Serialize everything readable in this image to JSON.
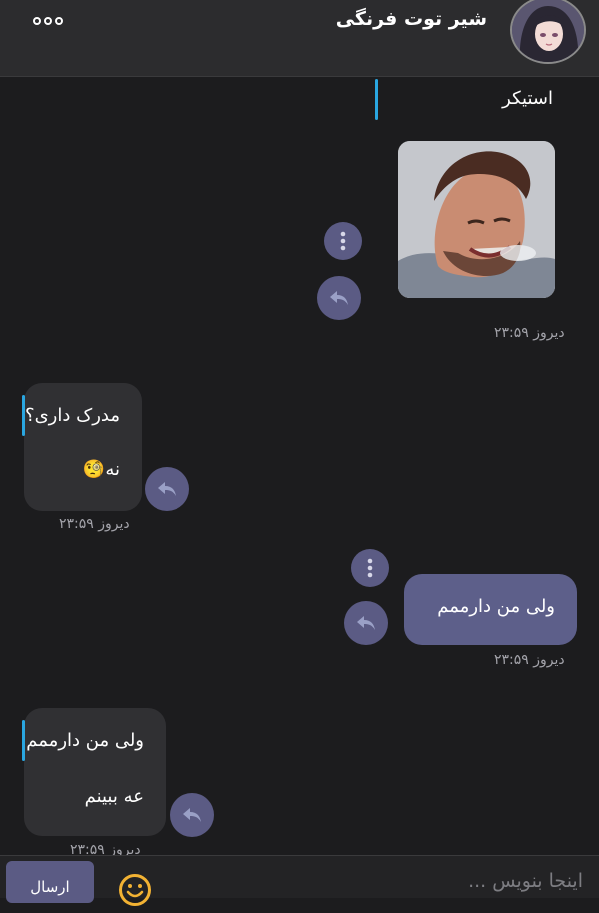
{
  "header": {
    "contact_name": "شیر توت فرنگی",
    "menu_icon": "more-dots-icon",
    "avatar": "anime-avatar"
  },
  "messages": [
    {
      "id": 1,
      "direction": "outgoing",
      "reply_preview": "استیکر",
      "type": "sticker",
      "sticker": "man-laughing-sticker",
      "time": "دیروز ۲۳:۵۹"
    },
    {
      "id": 2,
      "direction": "incoming",
      "reply_preview": "مدرک داری؟",
      "text": "نه🧐",
      "time": "دیروز ۲۳:۵۹"
    },
    {
      "id": 3,
      "direction": "outgoing",
      "text": "ولی من دارممم",
      "time": "دیروز ۲۳:۵۹"
    },
    {
      "id": 4,
      "direction": "incoming",
      "reply_preview": "ولی من دارممم",
      "text": "عه ببینم",
      "time": "دیروز ۲۳:۵۹"
    }
  ],
  "composer": {
    "placeholder": "اینجا بنویس ...",
    "send_label": "ارسال",
    "emoji_icon": "smiley-icon"
  },
  "colors": {
    "background": "#1c1c1e",
    "header": "#2c2c2e",
    "incoming_bubble": "#303033",
    "outgoing_bubble": "#5d5f8a",
    "action_button": "#5b5b84",
    "reply_accent": "#2aa6e0",
    "emoji_accent": "#f2b233"
  }
}
